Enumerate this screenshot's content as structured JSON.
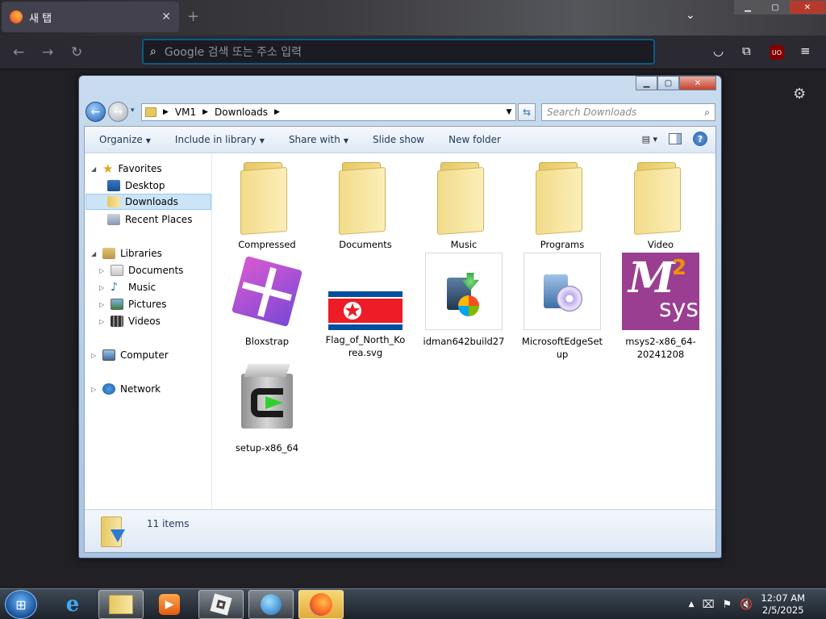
{
  "browser": {
    "tab_title": "새 탭",
    "url_placeholder": "Google 검색 또는 주소 입력",
    "ublock_label": "UO"
  },
  "explorer": {
    "breadcrumb": [
      "VM1",
      "Downloads"
    ],
    "search_placeholder": "Search Downloads",
    "toolbar": {
      "organize": "Organize",
      "include_in_library": "Include in library",
      "share_with": "Share with",
      "slide_show": "Slide show",
      "new_folder": "New folder"
    },
    "nav": {
      "favorites": "Favorites",
      "desktop": "Desktop",
      "downloads": "Downloads",
      "recent_places": "Recent Places",
      "libraries": "Libraries",
      "documents": "Documents",
      "music": "Music",
      "pictures": "Pictures",
      "videos": "Videos",
      "computer": "Computer",
      "network": "Network"
    },
    "files": [
      {
        "name": "Compressed"
      },
      {
        "name": "Documents"
      },
      {
        "name": "Music"
      },
      {
        "name": "Programs"
      },
      {
        "name": "Video"
      },
      {
        "name": "Bloxstrap"
      },
      {
        "name": "Flag_of_North_Korea.svg"
      },
      {
        "name": "idman642build27"
      },
      {
        "name": "MicrosoftEdgeSetup"
      },
      {
        "name": "msys2-x86_64-20241208"
      },
      {
        "name": "setup-x86_64"
      }
    ],
    "status": "11 items",
    "msys_logo_text": "sys",
    "msys_logo_num": "2"
  },
  "taskbar": {
    "time": "12:07 AM",
    "date": "2/5/2025"
  },
  "colors": {
    "nk_red": "#ED1C27",
    "nk_blue": "#024FA2",
    "msys_purple": "#9a3e92",
    "msys_orange": "#f39200"
  }
}
